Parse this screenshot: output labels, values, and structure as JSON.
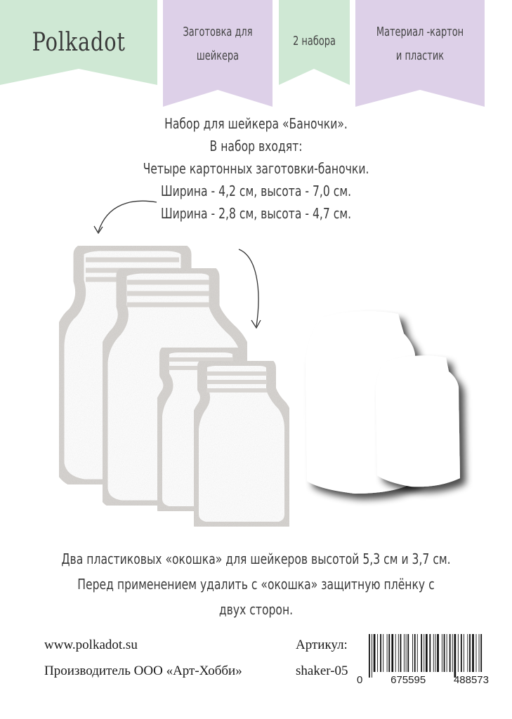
{
  "brand": {
    "name": "Polkadot",
    "color": "#cfe8d4"
  },
  "ribbons": [
    {
      "text_lines": [
        "Заготовка для",
        "шейкера"
      ],
      "color": "#ddd0e8"
    },
    {
      "text_lines": [
        "2 набора"
      ],
      "color": "#cfe8d4"
    },
    {
      "text_lines": [
        "Материал -картон",
        "и пластик"
      ],
      "color": "#ddd0e8"
    }
  ],
  "description": {
    "lines": [
      "Набор для шейкера «Баночки».",
      "В набор входят:",
      "Четыре картонных заготовки-баночки.",
      "Ширина - 4,2 см, высота - 7,0 см.",
      "Ширина - 2,8 см, высота - 4,7 см."
    ]
  },
  "bottom_text": {
    "lines": [
      "Два пластиковых «окошка» для шейкеров высотой 5,3 см и 3,7 см.",
      "Перед применением удалить с «окошка» защитную плёнку с",
      "двух сторон."
    ]
  },
  "footer": {
    "website": "www.polkadot.su",
    "manufacturer": "Производитель ООО «Арт-Хобби»",
    "article_label": "Артикул:",
    "article_value": "shaker-05",
    "barcode_digits": [
      "0",
      "675595",
      "488573"
    ]
  },
  "icons": [
    "arrow-left-icon",
    "arrow-right-icon"
  ]
}
